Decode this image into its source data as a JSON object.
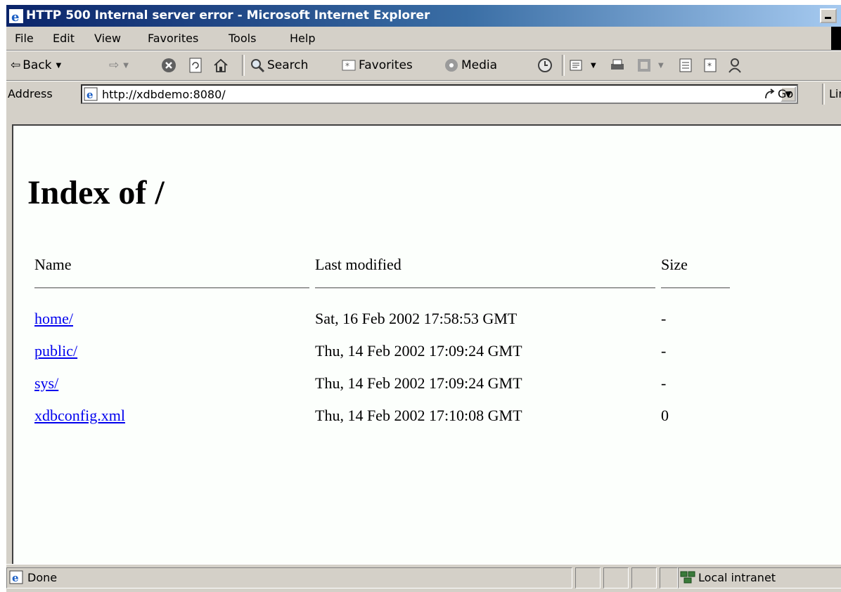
{
  "window": {
    "title": "HTTP 500 Internal server error - Microsoft Internet Explorer"
  },
  "menu": [
    "File",
    "Edit",
    "View",
    "Favorites",
    "Tools",
    "Help"
  ],
  "toolbar": {
    "back_label": "Back",
    "search_label": "Search",
    "favorites_label": "Favorites",
    "media_label": "Media"
  },
  "address": {
    "label": "Address",
    "url": "http://xdbdemo:8080/",
    "go_label": "Go",
    "links_label": "Lir"
  },
  "page": {
    "heading": "Index of /",
    "columns": {
      "name": "Name",
      "modified": "Last modified",
      "size": "Size"
    },
    "rows": [
      {
        "name": "home/",
        "modified": "Sat, 16 Feb 2002 17:58:53 GMT",
        "size": "-"
      },
      {
        "name": "public/",
        "modified": "Thu, 14 Feb 2002 17:09:24 GMT",
        "size": "-"
      },
      {
        "name": "sys/",
        "modified": "Thu, 14 Feb 2002 17:09:24 GMT",
        "size": "-"
      },
      {
        "name": "xdbconfig.xml",
        "modified": "Thu, 14 Feb 2002 17:10:08 GMT",
        "size": "0"
      }
    ]
  },
  "status": {
    "text": "Done",
    "zone": "Local intranet"
  }
}
